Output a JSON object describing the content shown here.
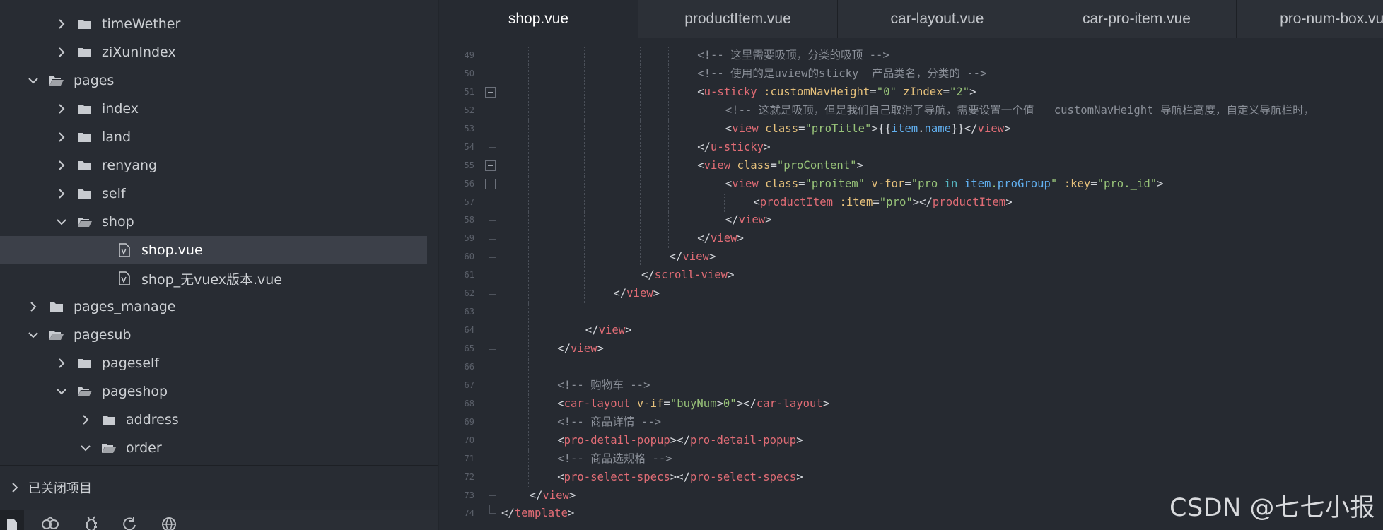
{
  "sidebar": {
    "tree": [
      {
        "label": "timeWether",
        "type": "folder",
        "depth": 2,
        "expanded": false
      },
      {
        "label": "ziXunIndex",
        "type": "folder",
        "depth": 2,
        "expanded": false
      },
      {
        "label": "pages",
        "type": "folder",
        "depth": 1,
        "expanded": true
      },
      {
        "label": "index",
        "type": "folder",
        "depth": 2,
        "expanded": false
      },
      {
        "label": "land",
        "type": "folder",
        "depth": 2,
        "expanded": false
      },
      {
        "label": "renyang",
        "type": "folder",
        "depth": 2,
        "expanded": false
      },
      {
        "label": "self",
        "type": "folder",
        "depth": 2,
        "expanded": false
      },
      {
        "label": "shop",
        "type": "folder",
        "depth": 2,
        "expanded": true
      },
      {
        "label": "shop.vue",
        "type": "file",
        "depth": 3,
        "selected": true
      },
      {
        "label": "shop_无vuex版本.vue",
        "type": "file",
        "depth": 3
      },
      {
        "label": "pages_manage",
        "type": "folder",
        "depth": 1,
        "expanded": false
      },
      {
        "label": "pagesub",
        "type": "folder",
        "depth": 1,
        "expanded": true
      },
      {
        "label": "pageself",
        "type": "folder",
        "depth": 2,
        "expanded": false
      },
      {
        "label": "pageshop",
        "type": "folder",
        "depth": 2,
        "expanded": true
      },
      {
        "label": "address",
        "type": "folder",
        "depth": 3,
        "expanded": false
      },
      {
        "label": "order",
        "type": "folder",
        "depth": 3,
        "expanded": true
      }
    ],
    "closed_projects_label": "已关闭项目",
    "toolbar_icons": [
      "files-icon",
      "plugin-icon",
      "bug-icon",
      "refresh-icon",
      "globe-icon"
    ]
  },
  "editor": {
    "tabs": [
      {
        "label": "shop.vue",
        "active": true
      },
      {
        "label": "productItem.vue",
        "active": false
      },
      {
        "label": "car-layout.vue",
        "active": false
      },
      {
        "label": "car-pro-item.vue",
        "active": false
      },
      {
        "label": "pro-num-box.vue",
        "active": false
      }
    ],
    "lines": [
      {
        "num": "49",
        "indent": 7,
        "fold": "none",
        "segs": [
          [
            "c-comment",
            "<!-- 这里需要吸顶，分类的吸顶 -->"
          ]
        ]
      },
      {
        "num": "50",
        "indent": 7,
        "fold": "none",
        "segs": [
          [
            "c-comment",
            "<!-- 使用的是uview的sticky  产品类名，分类的 -->"
          ]
        ]
      },
      {
        "num": "51",
        "indent": 7,
        "fold": "open",
        "segs": [
          [
            "c-punct",
            "<"
          ],
          [
            "c-tag",
            "u-sticky"
          ],
          [
            "c-plain",
            " "
          ],
          [
            "c-attr",
            ":customNavHeight"
          ],
          [
            "c-punct",
            "="
          ],
          [
            "c-str",
            "\"0\""
          ],
          [
            "c-plain",
            " "
          ],
          [
            "c-attr",
            "zIndex"
          ],
          [
            "c-punct",
            "="
          ],
          [
            "c-str",
            "\"2\""
          ],
          [
            "c-punct",
            ">"
          ]
        ]
      },
      {
        "num": "52",
        "indent": 8,
        "fold": "none",
        "segs": [
          [
            "c-comment",
            "<!-- 这就是吸顶，但是我们自己取消了导航，需要设置一个值   customNavHeight 导航栏高度，自定义导航栏时，"
          ]
        ]
      },
      {
        "num": "53",
        "indent": 8,
        "fold": "none",
        "segs": [
          [
            "c-punct",
            "<"
          ],
          [
            "c-tag",
            "view"
          ],
          [
            "c-plain",
            " "
          ],
          [
            "c-attr",
            "class"
          ],
          [
            "c-punct",
            "="
          ],
          [
            "c-str",
            "\"proTitle\""
          ],
          [
            "c-punct",
            ">{{"
          ],
          [
            "c-prop",
            "item"
          ],
          [
            "c-punct",
            "."
          ],
          [
            "c-prop",
            "name"
          ],
          [
            "c-punct",
            "}}</"
          ],
          [
            "c-tag",
            "view"
          ],
          [
            "c-punct",
            ">"
          ]
        ]
      },
      {
        "num": "54",
        "indent": 7,
        "fold": "tick",
        "segs": [
          [
            "c-punct",
            "</"
          ],
          [
            "c-tag",
            "u-sticky"
          ],
          [
            "c-punct",
            ">"
          ]
        ]
      },
      {
        "num": "55",
        "indent": 7,
        "fold": "open",
        "segs": [
          [
            "c-punct",
            "<"
          ],
          [
            "c-tag",
            "view"
          ],
          [
            "c-plain",
            " "
          ],
          [
            "c-attr",
            "class"
          ],
          [
            "c-punct",
            "="
          ],
          [
            "c-str",
            "\"proContent\""
          ],
          [
            "c-punct",
            ">"
          ]
        ]
      },
      {
        "num": "56",
        "indent": 8,
        "fold": "open",
        "segs": [
          [
            "c-punct",
            "<"
          ],
          [
            "c-tag",
            "view"
          ],
          [
            "c-plain",
            " "
          ],
          [
            "c-attr",
            "class"
          ],
          [
            "c-punct",
            "="
          ],
          [
            "c-str",
            "\"proitem\""
          ],
          [
            "c-plain",
            " "
          ],
          [
            "c-attr",
            "v-for"
          ],
          [
            "c-punct",
            "="
          ],
          [
            "c-str",
            "\"pro "
          ],
          [
            "c-kw",
            "in"
          ],
          [
            "c-str",
            " "
          ],
          [
            "c-prop",
            "item"
          ],
          [
            "c-str",
            "."
          ],
          [
            "c-prop",
            "proGroup"
          ],
          [
            "c-str",
            "\""
          ],
          [
            "c-plain",
            " "
          ],
          [
            "c-attr",
            ":key"
          ],
          [
            "c-punct",
            "="
          ],
          [
            "c-str",
            "\"pro._id\""
          ],
          [
            "c-punct",
            ">"
          ]
        ]
      },
      {
        "num": "57",
        "indent": 9,
        "fold": "none",
        "segs": [
          [
            "c-punct",
            "<"
          ],
          [
            "c-tag",
            "productItem"
          ],
          [
            "c-plain",
            " "
          ],
          [
            "c-attr",
            ":item"
          ],
          [
            "c-punct",
            "="
          ],
          [
            "c-str",
            "\"pro\""
          ],
          [
            "c-punct",
            "></"
          ],
          [
            "c-tag",
            "productItem"
          ],
          [
            "c-punct",
            ">"
          ]
        ]
      },
      {
        "num": "58",
        "indent": 8,
        "fold": "tick",
        "segs": [
          [
            "c-punct",
            "</"
          ],
          [
            "c-tag",
            "view"
          ],
          [
            "c-punct",
            ">"
          ]
        ]
      },
      {
        "num": "59",
        "indent": 7,
        "fold": "tick",
        "segs": [
          [
            "c-punct",
            "</"
          ],
          [
            "c-tag",
            "view"
          ],
          [
            "c-punct",
            ">"
          ]
        ]
      },
      {
        "num": "60",
        "indent": 6,
        "fold": "tick",
        "segs": [
          [
            "c-punct",
            "</"
          ],
          [
            "c-tag",
            "view"
          ],
          [
            "c-punct",
            ">"
          ]
        ]
      },
      {
        "num": "61",
        "indent": 5,
        "fold": "tick",
        "segs": [
          [
            "c-punct",
            "</"
          ],
          [
            "c-tag",
            "scroll-view"
          ],
          [
            "c-punct",
            ">"
          ]
        ]
      },
      {
        "num": "62",
        "indent": 4,
        "fold": "tick",
        "segs": [
          [
            "c-punct",
            "</"
          ],
          [
            "c-tag",
            "view"
          ],
          [
            "c-punct",
            ">"
          ]
        ]
      },
      {
        "num": "63",
        "indent": 3,
        "fold": "none",
        "segs": []
      },
      {
        "num": "64",
        "indent": 3,
        "fold": "tick",
        "segs": [
          [
            "c-punct",
            "</"
          ],
          [
            "c-tag",
            "view"
          ],
          [
            "c-punct",
            ">"
          ]
        ]
      },
      {
        "num": "65",
        "indent": 2,
        "fold": "tick",
        "segs": [
          [
            "c-punct",
            "</"
          ],
          [
            "c-tag",
            "view"
          ],
          [
            "c-punct",
            ">"
          ]
        ]
      },
      {
        "num": "66",
        "indent": 2,
        "fold": "none",
        "segs": []
      },
      {
        "num": "67",
        "indent": 2,
        "fold": "none",
        "segs": [
          [
            "c-comment",
            "<!-- 购物车 -->"
          ]
        ]
      },
      {
        "num": "68",
        "indent": 2,
        "fold": "none",
        "segs": [
          [
            "c-punct",
            "<"
          ],
          [
            "c-tag",
            "car-layout"
          ],
          [
            "c-plain",
            " "
          ],
          [
            "c-attr",
            "v-if"
          ],
          [
            "c-punct",
            "="
          ],
          [
            "c-str",
            "\"buyNum"
          ],
          [
            "c-punct",
            ">"
          ],
          [
            "c-str",
            "0\""
          ],
          [
            "c-punct",
            "></"
          ],
          [
            "c-tag",
            "car-layout"
          ],
          [
            "c-punct",
            ">"
          ]
        ]
      },
      {
        "num": "69",
        "indent": 2,
        "fold": "none",
        "segs": [
          [
            "c-comment",
            "<!-- 商品详情 -->"
          ]
        ]
      },
      {
        "num": "70",
        "indent": 2,
        "fold": "none",
        "segs": [
          [
            "c-punct",
            "<"
          ],
          [
            "c-tag",
            "pro-detail-popup"
          ],
          [
            "c-punct",
            "></"
          ],
          [
            "c-tag",
            "pro-detail-popup"
          ],
          [
            "c-punct",
            ">"
          ]
        ]
      },
      {
        "num": "71",
        "indent": 2,
        "fold": "none",
        "segs": [
          [
            "c-comment",
            "<!-- 商品选规格 -->"
          ]
        ]
      },
      {
        "num": "72",
        "indent": 2,
        "fold": "none",
        "segs": [
          [
            "c-punct",
            "<"
          ],
          [
            "c-tag",
            "pro-select-specs"
          ],
          [
            "c-punct",
            "></"
          ],
          [
            "c-tag",
            "pro-select-specs"
          ],
          [
            "c-punct",
            ">"
          ]
        ]
      },
      {
        "num": "73",
        "indent": 1,
        "fold": "tick",
        "segs": [
          [
            "c-punct",
            "</"
          ],
          [
            "c-tag",
            "view"
          ],
          [
            "c-punct",
            ">"
          ]
        ]
      },
      {
        "num": "74",
        "indent": 0,
        "fold": "end",
        "segs": [
          [
            "c-punct",
            "</"
          ],
          [
            "c-tag",
            "template"
          ],
          [
            "c-punct",
            ">"
          ]
        ]
      }
    ]
  },
  "watermark": "CSDN @七七小报"
}
